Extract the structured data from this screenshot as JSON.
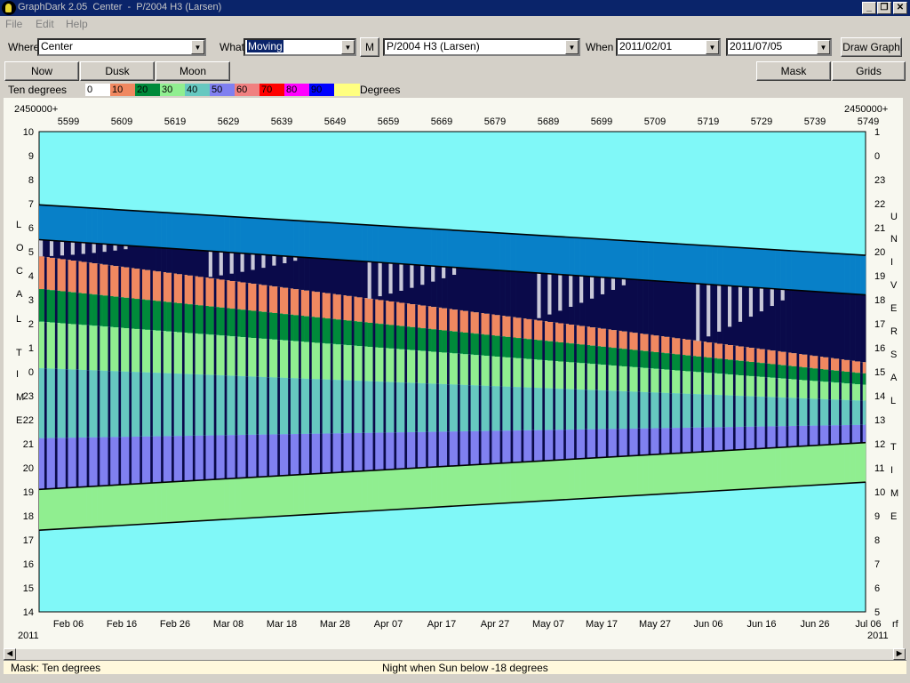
{
  "window": {
    "title": "GraphDark 2.05  Center  -  P/2004 H3 (Larsen)",
    "minimize_glyph": "_",
    "restore_glyph": "❐",
    "close_glyph": "✕"
  },
  "menu": [
    "File",
    "Edit",
    "Help"
  ],
  "toolbar": {
    "where_label": "Where",
    "where_value": "Center",
    "what_label": "What",
    "what_value": "Moving",
    "m_label": "M",
    "object_value": "P/2004 H3 (Larsen)",
    "when_label": "When",
    "start_date": "2011/02/01",
    "end_date": "2011/07/05",
    "draw_label": "Draw Graph"
  },
  "buttons": {
    "now": "Now",
    "dusk": "Dusk",
    "moon": "Moon",
    "mask": "Mask",
    "grids": "Grids"
  },
  "legend": {
    "title": "Ten degrees",
    "unit": "Degrees",
    "items": [
      {
        "label": "0",
        "color": "#ffffff"
      },
      {
        "label": "10",
        "color": "#f08860"
      },
      {
        "label": "20",
        "color": "#008a3a"
      },
      {
        "label": "30",
        "color": "#90ee90"
      },
      {
        "label": "40",
        "color": "#66c8c0"
      },
      {
        "label": "50",
        "color": "#8080f0"
      },
      {
        "label": "60",
        "color": "#f08080"
      },
      {
        "label": "70",
        "color": "#ff0000"
      },
      {
        "label": "80",
        "color": "#ff00ff"
      },
      {
        "label": "90",
        "color": "#0000ff"
      },
      {
        "label": "",
        "color": "#ffff80"
      }
    ]
  },
  "status": {
    "mask": "Mask:  Ten degrees",
    "night": "Night when Sun below -18 degrees"
  },
  "chart_data": {
    "type": "heatmap",
    "jd_offset_label": "2450000+",
    "jd_ticks": [
      "5599",
      "5609",
      "5619",
      "5629",
      "5639",
      "5649",
      "5659",
      "5669",
      "5679",
      "5689",
      "5699",
      "5709",
      "5719",
      "5729",
      "5739",
      "5749"
    ],
    "date_ticks": [
      "Feb 06",
      "Feb 16",
      "Feb 26",
      "Mar 08",
      "Mar 18",
      "Mar 28",
      "Apr 07",
      "Apr 17",
      "Apr 27",
      "May 07",
      "May 17",
      "May 27",
      "Jun 06",
      "Jun 16",
      "Jun 26",
      "Jul 06"
    ],
    "year_left": "2011",
    "year_right": "2011",
    "corner_right": "rf",
    "local_time_ticks": [
      "10",
      "9",
      "8",
      "7",
      "6",
      "5",
      "4",
      "3",
      "2",
      "1",
      "0",
      "23",
      "22",
      "21",
      "20",
      "19",
      "18",
      "17",
      "16",
      "15",
      "14"
    ],
    "universal_time_ticks": [
      "1",
      "0",
      "23",
      "22",
      "21",
      "20",
      "19",
      "18",
      "17",
      "16",
      "15",
      "14",
      "13",
      "12",
      "11",
      "10",
      "9",
      "8",
      "7",
      "6",
      "5"
    ],
    "left_axis_label": "LOCAL TIME",
    "right_axis_label": "UNIVERSAL TIME",
    "colors": {
      "background": "#80f8f8",
      "twilight": "#0880c8",
      "night": "#0a0a4a",
      "moon": "#c8c8d8",
      "band10": "#f08860",
      "band20": "#008a3a",
      "band30": "#90ee90",
      "band40": "#66c8c0",
      "band50": "#8080f0"
    },
    "dusk_start_hour": [
      18.5,
      20.6
    ],
    "dawn_end_hour": [
      6.95,
      4.85
    ],
    "night_start_hour": [
      19.0,
      21.0
    ],
    "night_end_hour": [
      5.5,
      3.2
    ],
    "rise_hour": [
      19.1,
      21.05
    ],
    "set_hour": [
      17.4,
      19.4
    ]
  }
}
